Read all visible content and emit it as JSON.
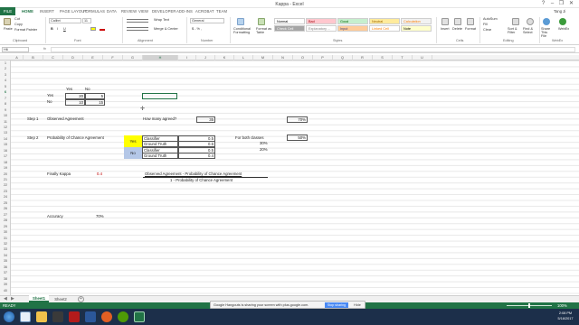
{
  "window": {
    "title": "Kappa - Excel",
    "user": "Tang Ji",
    "controls": {
      "help": "?",
      "minimize": "–",
      "restore": "❐",
      "close": "✕"
    }
  },
  "tabs": [
    "HOME",
    "INSERT",
    "PAGE LAYOUT",
    "FORMULAS",
    "DATA",
    "REVIEW",
    "VIEW",
    "DEVELOPER",
    "ADD-INS",
    "ACROBAT",
    "TEAM"
  ],
  "file_tab": "FILE",
  "ribbon": {
    "clipboard": {
      "paste": "Paste",
      "cut": "Cut",
      "copy": "Copy",
      "format_painter": "Format Painter",
      "label": "Clipboard"
    },
    "font": {
      "name": "Calibri",
      "size": "11",
      "bold": "B",
      "italic": "I",
      "underline": "U",
      "label": "Font"
    },
    "alignment": {
      "wrap": "Wrap Text",
      "merge": "Merge & Center",
      "label": "Alignment"
    },
    "number": {
      "format": "General",
      "symbols": "$ - % ,",
      "label": "Number"
    },
    "styles": {
      "conditional": "Conditional Formatting",
      "format_table": "Format as Table",
      "cells": [
        {
          "name": "Normal",
          "bg": "#ffffff",
          "fg": "#000000"
        },
        {
          "name": "Bad",
          "bg": "#ffc7ce",
          "fg": "#9c0006"
        },
        {
          "name": "Good",
          "bg": "#c6efce",
          "fg": "#006100"
        },
        {
          "name": "Neutral",
          "bg": "#ffeb9c",
          "fg": "#9c6500"
        },
        {
          "name": "Calculation",
          "bg": "#f2f2f2",
          "fg": "#fa7d00"
        },
        {
          "name": "Check Cell",
          "bg": "#a5a5a5",
          "fg": "#ffffff"
        },
        {
          "name": "Explanatory ...",
          "bg": "#ffffff",
          "fg": "#7f7f7f"
        },
        {
          "name": "Input",
          "bg": "#ffcc99",
          "fg": "#3f3f76"
        },
        {
          "name": "Linked Cell",
          "bg": "#ffffff",
          "fg": "#fa7d00"
        },
        {
          "name": "Note",
          "bg": "#ffffcc",
          "fg": "#000000"
        }
      ],
      "label": "Styles"
    },
    "cells_group": {
      "insert": "Insert",
      "delete": "Delete",
      "format": "Format",
      "label": "Cells"
    },
    "editing": {
      "autosum": "AutoSum",
      "fill": "Fill",
      "clear": "Clear",
      "sort": "Sort & Filter",
      "find": "Find & Select",
      "label": "Editing"
    },
    "share": {
      "share": "Share This File",
      "webex": "WebEx",
      "label": "WebEx"
    }
  },
  "formula_bar": {
    "name_box": "H6",
    "fx": "fx",
    "content": ""
  },
  "columns": [
    "A",
    "B",
    "C",
    "D",
    "E",
    "F",
    "G",
    "H",
    "I",
    "J",
    "K",
    "L",
    "M",
    "N",
    "O",
    "P",
    "Q",
    "R",
    "S",
    "T",
    "U"
  ],
  "rows": [
    "1",
    "2",
    "3",
    "4",
    "5",
    "6",
    "7",
    "8",
    "9",
    "10",
    "11",
    "12",
    "13",
    "14",
    "15",
    "16",
    "17",
    "18",
    "19",
    "20",
    "21",
    "22",
    "23",
    "24",
    "25",
    "26",
    "27",
    "28",
    "29",
    "30",
    "31",
    "32",
    "33",
    "34",
    "35",
    "36",
    "37",
    "38",
    "39",
    "40"
  ],
  "sheet": {
    "yes_hdr": "Yes",
    "no_hdr": "No",
    "yes_row": "Yes",
    "no_row": "No",
    "m_yy": "20",
    "m_yn": "5",
    "m_ny": "10",
    "m_nn": "15",
    "step1": "Step 1",
    "observed": "Observed Agreement",
    "how_many": "How many agreed?",
    "agreed_val": "35",
    "obs_pct": "70%",
    "step2": "Step 2",
    "prob_chance": "Probability of Chance Agreement",
    "yes_tag": "Yes",
    "no_tag": "No",
    "classifier1": "Classifier",
    "ground1": "Ground Truth",
    "classifier2": "Classifier",
    "ground2": "Ground Truth",
    "c1_val": "0.5",
    "g1_val": "0.6",
    "c2_val": "0.5",
    "g2_val": "0.4",
    "both_classes": "For both classes",
    "both_pct": "50%",
    "pct30": "30%",
    "pct20": "20%",
    "finally": "Finally Kappa",
    "kappa_val": "0.4",
    "formula_num": "Observed Agreement - Probability of Chance Agreement",
    "formula_den": "1 - Probability of Chance Agreement",
    "accuracy": "Accuracy",
    "accuracy_val": "70%"
  },
  "sheet_tabs": [
    "Sheet1",
    "Sheet2"
  ],
  "status": {
    "ready": "READY",
    "zoom": "100%"
  },
  "notice": {
    "text": "Google Hangouts is sharing your screen with plus.google.com.",
    "stop": "Stop sharing",
    "hide": "Hide"
  },
  "clock": {
    "time": "2:08 PM",
    "date": "5/16/2017"
  }
}
